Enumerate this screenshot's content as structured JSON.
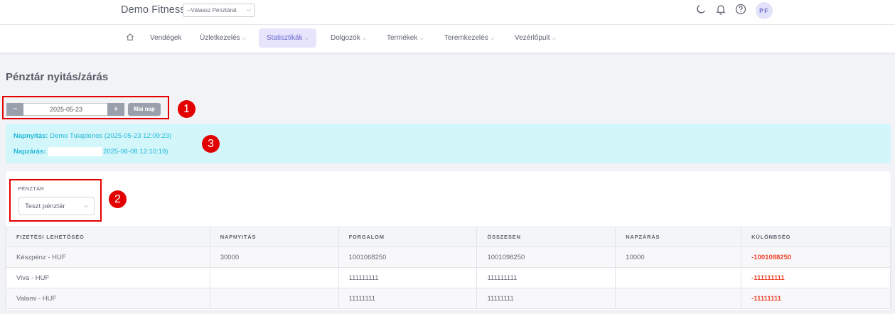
{
  "header": {
    "brand": "Demo Fitness",
    "store_select": "--Válassz Pénztárat",
    "avatar_initials": "PF"
  },
  "nav": {
    "items": [
      {
        "label": "Vendégek",
        "dropdown": false
      },
      {
        "label": "Üzletkezelés",
        "dropdown": true
      },
      {
        "label": "Statisztikák",
        "dropdown": true,
        "active": true
      },
      {
        "label": "Dolgozók",
        "dropdown": true
      },
      {
        "label": "Termékek",
        "dropdown": true
      },
      {
        "label": "Teremkezelés",
        "dropdown": true
      },
      {
        "label": "Vezérlőpult",
        "dropdown": true
      }
    ]
  },
  "page": {
    "title": "Pénztár nyitás/zárás"
  },
  "date_picker": {
    "minus": "−",
    "value": "2025-05-23",
    "plus": "+",
    "today_label": "Mai nap"
  },
  "annotations": [
    "1",
    "2",
    "3"
  ],
  "info": {
    "open_label": "Napnyitás:",
    "open_value": "Demo Tulajdonos (2025-05-23 12:09:23)",
    "close_label": "Napzárás:",
    "close_value": "2025-06-08 12:10:19)"
  },
  "register": {
    "label": "PÉNZTÁR",
    "selected": "Teszt pénztár"
  },
  "table": {
    "headers": [
      "FIZETÉSI LEHETŐSÉG",
      "NAPNYITÁS",
      "FORGALOM",
      "ÖSSZESEN",
      "NAPZÁRÁS",
      "KÜLÖNBSÉG"
    ],
    "rows": [
      [
        "Készpénz - HUF",
        "30000",
        "1001068250",
        "1001098250",
        "10000",
        "-1001088250"
      ],
      [
        "Viva - HUF",
        "",
        "111111111",
        "111111111",
        "",
        "-111111111"
      ],
      [
        "Valami - HUF",
        "",
        "11111111",
        "11111111",
        "",
        "-11111111"
      ]
    ]
  },
  "colors": {
    "accent": "#6c66cf",
    "info_bg": "#d3f6fb",
    "info_text": "#22b8d6",
    "negative": "#f0432c",
    "annotation": "#e30000"
  }
}
